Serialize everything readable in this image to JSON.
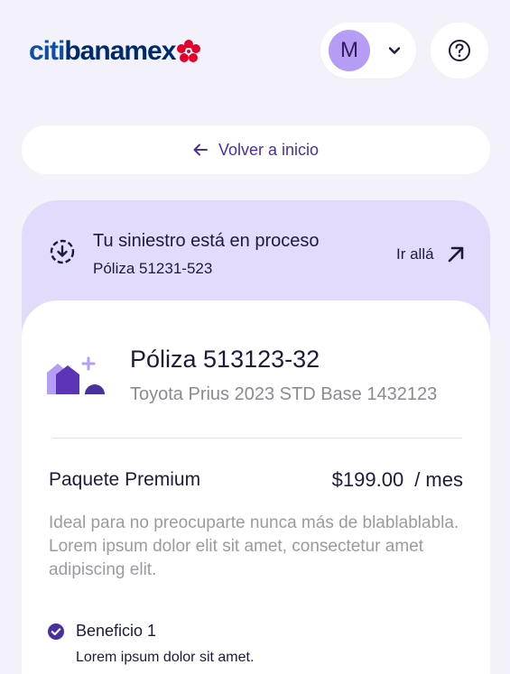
{
  "header": {
    "logo_text_citi": "citi",
    "logo_text_rest": "banamex",
    "avatar_initial": "M"
  },
  "nav": {
    "back_label": "Volver a inicio"
  },
  "status": {
    "title": "Tu siniestro está en proceso",
    "subtitle": "Póliza 51231-523",
    "action_label": "Ir allá"
  },
  "policy": {
    "title": "Póliza 513123-32",
    "vehicle": "Toyota Prius 2023 STD Base 1432123",
    "package_name": "Paquete Premium",
    "price": "$199.00",
    "period": "/ mes",
    "description": "Ideal para no preocuparte nunca más de blablablabla. Lorem ipsum dolor elit sit amet, consectetur amet adipiscing elit."
  },
  "benefits": [
    {
      "title": "Beneficio 1",
      "description": "Lorem ipsum dolor sit amet."
    }
  ],
  "colors": {
    "background": "#f3f2fb",
    "accent": "#4a2fa0",
    "status_bg": "#e3dbfb",
    "avatar_bg": "#b59cf5",
    "muted_text": "#8a8a94",
    "logo_red": "#e4002b"
  }
}
